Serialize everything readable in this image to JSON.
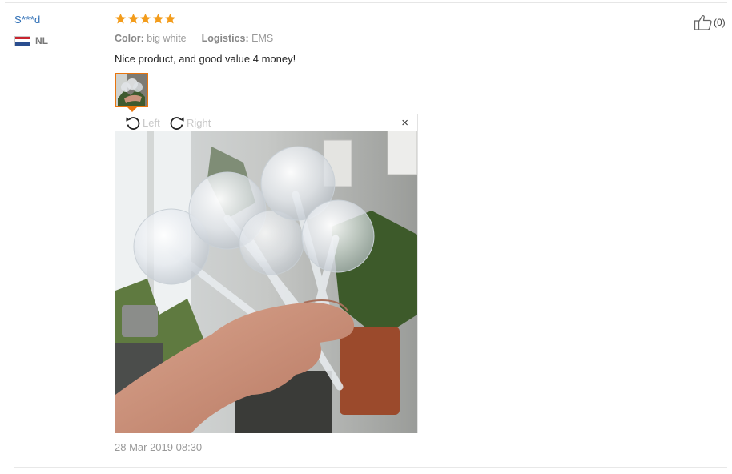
{
  "buyer": {
    "name": "S***d",
    "country_code": "NL",
    "flag_icon": "netherlands-flag-icon",
    "flag_colors": [
      "#c8242f",
      "#ffffff",
      "#2a4d8f"
    ]
  },
  "review": {
    "rating": 5,
    "rating_max": 5,
    "star_icon": "star-icon",
    "star_color": "#f39c1b",
    "attributes": [
      {
        "label": "Color:",
        "value": "big white"
      },
      {
        "label": "Logistics:",
        "value": "EMS"
      }
    ],
    "comment": "Nice product, and good value 4 money!",
    "date": "28 Mar 2019 08:30"
  },
  "viewer": {
    "rotate_left_label": "Left",
    "rotate_right_label": "Right",
    "rotate_left_icon": "rotate-left-icon",
    "rotate_right_icon": "rotate-right-icon",
    "close_label": "×",
    "close_icon": "close-icon",
    "thumbnail_accent": "#e8750e"
  },
  "helpful": {
    "icon": "thumbs-up-icon",
    "count_label": "(0)"
  }
}
